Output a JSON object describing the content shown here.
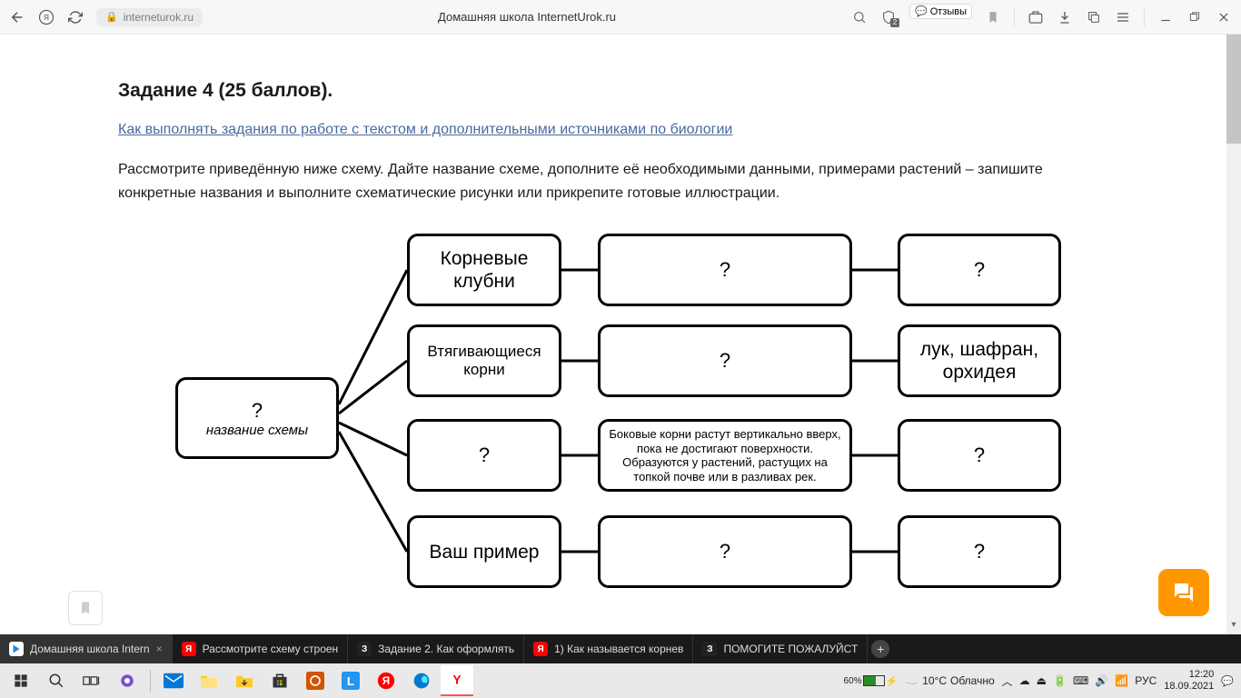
{
  "browser": {
    "url": "interneturok.ru",
    "page_title": "Домашняя школа InternetUrok.ru",
    "reviews_label": "Отзывы",
    "shield_badge": "2"
  },
  "task": {
    "title": "Задание 4 (25 баллов).",
    "link": "Как выполнять задания по работе с текстом и дополнительными источниками по биологии",
    "description": "Рассмотрите приведённую ниже схему. Дайте название схеме, дополните её необходимыми данными, примерами растений – запишите конкретные названия и выполните схематические рисунки или прикрепите готовые иллюстрации."
  },
  "diagram": {
    "root_q": "?",
    "root_sub": "название схемы",
    "rows": [
      {
        "c1": "Корневые клубни",
        "c2": "?",
        "c3": "?"
      },
      {
        "c1": "Втягивающиеся корни",
        "c2": "?",
        "c3": "лук, шафран, орхидея"
      },
      {
        "c1": "?",
        "c2": "Боковые корни растут вертикально вверх, пока не достигают поверхности. Образуются у растений, растущих на топкой почве или в разливах рек.",
        "c3": "?"
      },
      {
        "c1": "Ваш пример",
        "c2": "?",
        "c3": "?"
      }
    ]
  },
  "tabs": [
    {
      "label": "Домашняя школа Intern",
      "icon_bg": "#fff",
      "active": true
    },
    {
      "label": "Рассмотрите схему строен",
      "icon_bg": "#ff0000"
    },
    {
      "label": "Задание 2. Как оформлять",
      "icon_bg": "#1a1a1a",
      "letter": "З"
    },
    {
      "label": "1) Как называется корнев",
      "icon_bg": "#ff0000"
    },
    {
      "label": "ПОМОГИТЕ ПОЖАЛУЙСТ",
      "icon_bg": "#1a1a1a",
      "letter": "З"
    }
  ],
  "taskbar": {
    "battery_pct": "60%",
    "weather_temp": "10°C",
    "weather_desc": "Облачно",
    "lang": "РУС",
    "time": "12:20",
    "date": "18.09.2021"
  }
}
